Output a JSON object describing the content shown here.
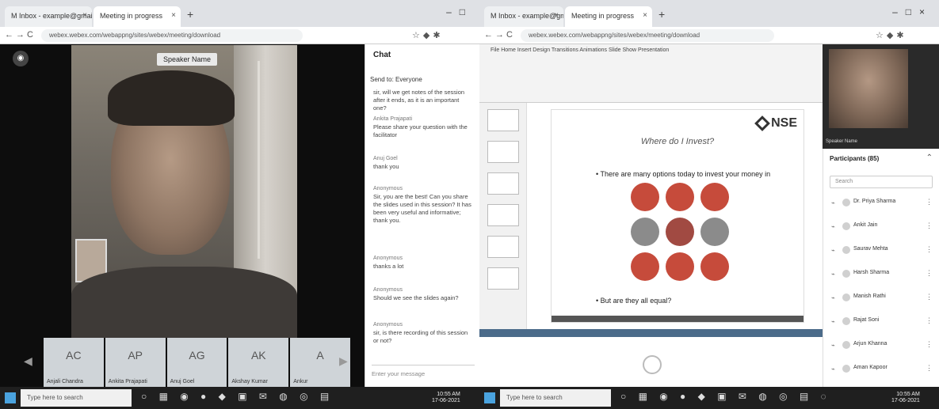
{
  "left": {
    "tabs": [
      {
        "label": "M Inbox - example@gmail.com"
      },
      {
        "label": "Meeting in progress"
      }
    ],
    "url": "webex.webex.com/webappng/sites/webex/meeting/download",
    "speaker_name": "Speaker Name",
    "strip_tiles": [
      {
        "initials": "AC",
        "name": "Anjali Chandra"
      },
      {
        "initials": "AP",
        "name": "Ankita Prajapati"
      },
      {
        "initials": "AG",
        "name": "Anuj Goel"
      },
      {
        "initials": "AK",
        "name": "Akshay Kumar"
      },
      {
        "initials": "A",
        "name": "Ankur"
      }
    ],
    "chat": {
      "title": "Chat",
      "to": "Send to: Everyone",
      "messages": [
        {
          "meta": "",
          "text": "sir, will we get notes of the session after it ends, as it is an important one?"
        },
        {
          "meta": "Ankita Prajapati",
          "text": "Please share your question with the facilitator"
        },
        {
          "meta": "Anuj Goel",
          "text": "thank you"
        },
        {
          "meta": "Anonymous",
          "text": "Sir, you are the best! Can you share the slides used in this session? It has been very useful and informative; thank you."
        },
        {
          "meta": "Anonymous",
          "text": "thanks a lot"
        },
        {
          "meta": "Anonymous",
          "text": "Should we see the slides again?"
        },
        {
          "meta": "Anonymous",
          "text": "sir, is there recording of this session or not?"
        }
      ],
      "input_placeholder": "Enter your message"
    },
    "taskbar_search": "Type here to search",
    "clock": {
      "time": "10:55 AM",
      "date": "17-06-2021"
    }
  },
  "right": {
    "tabs": [
      {
        "label": "M Inbox - example@gmail.com"
      },
      {
        "label": "Meeting in progress"
      }
    ],
    "url": "webex.webex.com/webappng/sites/webex/meeting/download",
    "ppt_title": "Presentation",
    "ribbon_tabs": "File  Home  Insert  Design  Transitions  Animations  Slide Show",
    "slide": {
      "logo": "NSE",
      "title": "Where do I Invest?",
      "bullet1": "There are many options today to invest your money in",
      "bullet2": "But are they all equal?",
      "circles": [
        {
          "color": "#c64b3b"
        },
        {
          "color": "#c64b3b"
        },
        {
          "color": "#c64b3b"
        },
        {
          "color": "#8b8b8b"
        },
        {
          "color": "#a14a42"
        },
        {
          "color": "#8b8b8b"
        },
        {
          "color": "#c64b3b"
        },
        {
          "color": "#c64b3b"
        },
        {
          "color": "#c64b3b"
        }
      ]
    },
    "participants": {
      "video_name": "Speaker Name",
      "title": "Participants (85)",
      "search": "Search",
      "list": [
        {
          "name": "Dr. Priya Sharma"
        },
        {
          "name": "Ankit Jain"
        },
        {
          "name": "Saurav Mehta"
        },
        {
          "name": "Harsh Sharma"
        },
        {
          "name": "Manish Rathi"
        },
        {
          "name": "Rajat Soni"
        },
        {
          "name": "Arjun Khanna"
        },
        {
          "name": "Aman Kapoor"
        }
      ]
    },
    "taskbar_search": "Type here to search",
    "clock": {
      "time": "10:55 AM",
      "date": "17-06-2021"
    }
  }
}
